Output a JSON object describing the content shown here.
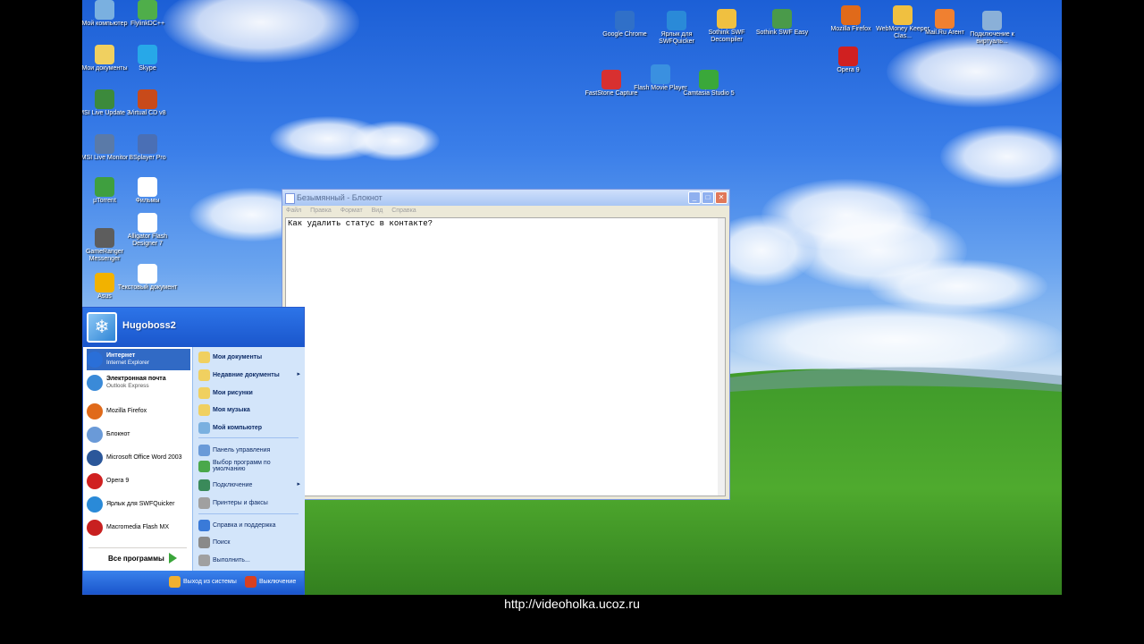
{
  "desktop": {
    "icons_left": [
      {
        "label": "Мой компьютер",
        "icon": "my-computer-icon",
        "color": "#7ab0e0"
      },
      {
        "label": "FlylinkDC++",
        "icon": "flylink-icon",
        "color": "#4fae4a"
      },
      {
        "label": "Мои документы",
        "icon": "my-documents-icon",
        "color": "#f0d060"
      },
      {
        "label": "Skype",
        "icon": "skype-icon",
        "color": "#27a8e8"
      },
      {
        "label": "MSI Live Update 3",
        "icon": "msi-live-update-icon",
        "color": "#3c8a3c"
      },
      {
        "label": "Virtual CD v8",
        "icon": "virtual-cd-icon",
        "color": "#c84a1a"
      },
      {
        "label": "MSI Live Monitor",
        "icon": "msi-live-monitor-icon",
        "color": "#5a7aa8"
      },
      {
        "label": "BSplayer Pro",
        "icon": "bsplayer-icon",
        "color": "#4a6fb5"
      },
      {
        "label": "µTorrent",
        "icon": "utorrent-icon",
        "color": "#3f9f3f"
      },
      {
        "label": "Фильмы",
        "icon": "text-file-icon",
        "color": "#ffffff"
      },
      {
        "label": "GameRanger Messenger",
        "icon": "gameranger-icon",
        "color": "#5d5d5d"
      },
      {
        "label": "Alligator Flash Designer 7",
        "icon": "alligator-flash-icon",
        "color": "#ffffff"
      },
      {
        "label": "Asus",
        "icon": "asus-icon",
        "color": "#f2b200"
      },
      {
        "label": "Текстовый документ",
        "icon": "text-document-icon",
        "color": "#ffffff"
      }
    ],
    "icons_top": [
      {
        "label": "Google Chrome",
        "icon": "google-chrome-icon",
        "color": "#3070c8"
      },
      {
        "label": "Ярлык для SWFQuicker",
        "icon": "swfquicker-icon",
        "color": "#2a8ad8"
      },
      {
        "label": "Sothink SWF Decompiler",
        "icon": "sothink-decompiler-icon",
        "color": "#f0c040"
      },
      {
        "label": "Sothink SWF Easy",
        "icon": "sothink-easy-icon",
        "color": "#4a9a4a"
      },
      {
        "label": "Mozilla Firefox",
        "icon": "firefox-icon",
        "color": "#e06a1a"
      },
      {
        "label": "WebMoney Keeper Clas...",
        "icon": "webmoney-icon",
        "color": "#f0c040"
      },
      {
        "label": "Mail.Ru Агент",
        "icon": "mailru-agent-icon",
        "color": "#f08030"
      },
      {
        "label": "Подключение к виртуаль...",
        "icon": "network-connection-icon",
        "color": "#8ab0d8"
      },
      {
        "label": "FastStone Capture",
        "icon": "faststone-icon",
        "color": "#d83030"
      },
      {
        "label": "Flash Movie Player",
        "icon": "flash-player-icon",
        "color": "#3a90e0"
      },
      {
        "label": "Camtasia Studio 5",
        "icon": "camtasia-icon",
        "color": "#3aa83a"
      },
      {
        "label": "Opera 9",
        "icon": "opera-icon",
        "color": "#d02020"
      }
    ]
  },
  "notepad": {
    "title": "Безымянный - Блокнот",
    "menu": [
      "Файл",
      "Правка",
      "Формат",
      "Вид",
      "Справка"
    ],
    "content": "Как удалить статус в контакте?",
    "buttons": {
      "minimize": "_",
      "maximize": "□",
      "close": "✕"
    }
  },
  "start_menu": {
    "username": "Hugoboss2",
    "pinned": [
      {
        "title": "Интернет",
        "subtitle": "Internet Explorer",
        "icon": "internet-explorer-icon",
        "color": "#2a6fd8",
        "active": true
      },
      {
        "title": "Электронная почта",
        "subtitle": "Outlook Express",
        "icon": "outlook-express-icon",
        "color": "#3a8ad8",
        "active": false
      }
    ],
    "recent": [
      {
        "title": "Mozilla Firefox",
        "icon": "firefox-icon",
        "color": "#e06a1a"
      },
      {
        "title": "Блокнот",
        "icon": "notepad-icon",
        "color": "#6a9ad8"
      },
      {
        "title": "Microsoft Office Word 2003",
        "icon": "word-icon",
        "color": "#2b579a"
      },
      {
        "title": "Opera 9",
        "icon": "opera-icon",
        "color": "#d02020"
      },
      {
        "title": "Ярлык для SWFQuicker",
        "icon": "swfquicker-icon",
        "color": "#2a8ad8"
      },
      {
        "title": "Macromedia Flash MX",
        "icon": "flash-mx-icon",
        "color": "#c82020"
      }
    ],
    "all_programs": "Все программы",
    "right": [
      {
        "label": "Мои документы",
        "icon": "my-documents-icon",
        "color": "#f0d060",
        "bold": true,
        "submenu": false
      },
      {
        "label": "Недавние документы",
        "icon": "recent-documents-icon",
        "color": "#f0d060",
        "bold": true,
        "submenu": true
      },
      {
        "label": "Мои рисунки",
        "icon": "my-pictures-icon",
        "color": "#f0d060",
        "bold": true,
        "submenu": false
      },
      {
        "label": "Моя музыка",
        "icon": "my-music-icon",
        "color": "#f0d060",
        "bold": true,
        "submenu": false
      },
      {
        "label": "Мой компьютер",
        "icon": "my-computer-icon",
        "color": "#7ab0e0",
        "bold": true,
        "submenu": false
      },
      {
        "label": "Панель управления",
        "icon": "control-panel-icon",
        "color": "#6a9ad8",
        "bold": false,
        "submenu": false
      },
      {
        "label": "Выбор программ по умолчанию",
        "icon": "default-programs-icon",
        "color": "#4aa84a",
        "bold": false,
        "submenu": false
      },
      {
        "label": "Подключение",
        "icon": "connect-icon",
        "color": "#3a8a5a",
        "bold": false,
        "submenu": true
      },
      {
        "label": "Принтеры и факсы",
        "icon": "printers-icon",
        "color": "#a0a0a0",
        "bold": false,
        "submenu": false
      },
      {
        "label": "Справка и поддержка",
        "icon": "help-icon",
        "color": "#3a7ad8",
        "bold": false,
        "submenu": false
      },
      {
        "label": "Поиск",
        "icon": "search-icon",
        "color": "#8a8a8a",
        "bold": false,
        "submenu": false
      },
      {
        "label": "Выполнить...",
        "icon": "run-icon",
        "color": "#a0a0a0",
        "bold": false,
        "submenu": false
      }
    ],
    "footer": {
      "logoff": "Выход из системы",
      "shutdown": "Выключение"
    }
  },
  "caption": "http://videoholka.ucoz.ru"
}
